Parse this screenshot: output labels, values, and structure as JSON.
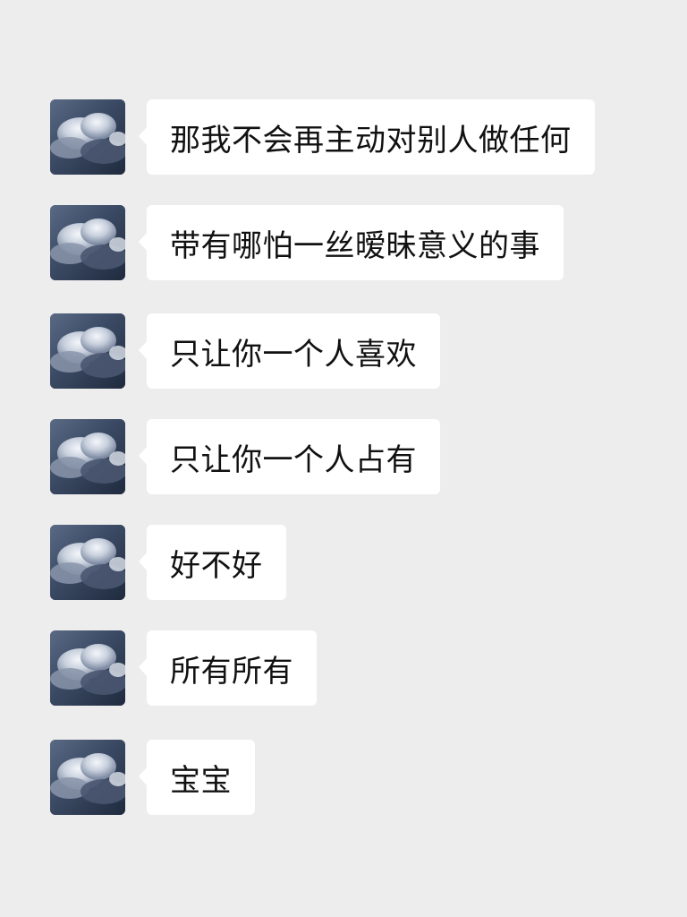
{
  "messages": [
    {
      "text": "那我不会再主动对别人做任何",
      "avatar": "cloud-avatar"
    },
    {
      "text": "带有哪怕一丝暧昧意义的事",
      "avatar": "cloud-avatar"
    },
    {
      "text": "只让你一个人喜欢",
      "avatar": "cloud-avatar"
    },
    {
      "text": "只让你一个人占有",
      "avatar": "cloud-avatar"
    },
    {
      "text": "好不好",
      "avatar": "cloud-avatar"
    },
    {
      "text": "所有所有",
      "avatar": "cloud-avatar"
    },
    {
      "text": "宝宝",
      "avatar": "cloud-avatar"
    }
  ],
  "colors": {
    "background": "#ededed",
    "bubble": "#ffffff",
    "text": "#111111"
  }
}
